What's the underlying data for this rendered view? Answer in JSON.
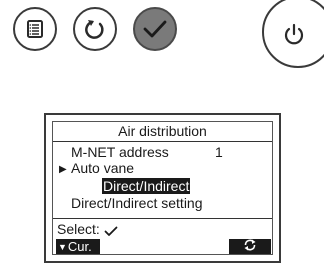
{
  "controls": {
    "menu_icon": "menu-list-icon",
    "return_icon": "return-arrow-icon",
    "select_icon": "checkmark-icon",
    "power_icon": "power-icon"
  },
  "screen": {
    "title": "Air distribution",
    "mnet_label": "M-NET address",
    "mnet_value": "1",
    "auto_vane_cursor": "▶",
    "auto_vane_label": "Auto vane",
    "auto_vane_value": "Direct/Indirect",
    "setting_label": "Direct/Indirect setting",
    "select_label": "Select:",
    "cursor_button_arrow": "▼",
    "cursor_button_label": "Cur."
  }
}
